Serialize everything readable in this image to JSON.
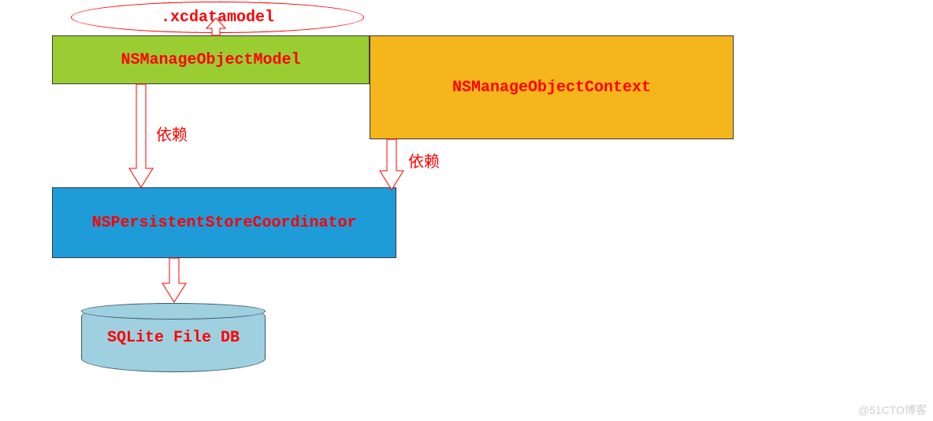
{
  "nodes": {
    "xcdatamodel": ".xcdatamodel",
    "managedObjectModel": "NSManageObjectModel",
    "managedObjectContext": "NSManageObjectContext",
    "persistentStoreCoordinator": "NSPersistentStoreCoordinator",
    "sqliteFileDb": "SQLite File DB"
  },
  "edges": {
    "modelToCoordinator": "依赖",
    "contextToCoordinator": "依赖"
  },
  "watermark": "@51CTO博客",
  "colors": {
    "green": "#9acd32",
    "orange": "#f4b61a",
    "blue": "#1e9cd8",
    "db": "#9ed0df",
    "text": "#ff0000",
    "connector": "#ff0000"
  },
  "chart_data": {
    "type": "diagram",
    "title": "Core Data Stack",
    "nodes": [
      {
        "id": "xcdatamodel",
        "label": ".xcdatamodel",
        "shape": "ellipse-outline"
      },
      {
        "id": "model",
        "label": "NSManageObjectModel",
        "shape": "rect",
        "fill": "#9acd32"
      },
      {
        "id": "context",
        "label": "NSManageObjectContext",
        "shape": "rect",
        "fill": "#f4b61a"
      },
      {
        "id": "coordinator",
        "label": "NSPersistentStoreCoordinator",
        "shape": "rect",
        "fill": "#1e9cd8"
      },
      {
        "id": "sqlite",
        "label": "SQLite File DB",
        "shape": "cylinder",
        "fill": "#9ed0df"
      }
    ],
    "edges": [
      {
        "from": "model",
        "to": "xcdatamodel",
        "style": "open-arrow-up"
      },
      {
        "from": "model",
        "to": "coordinator",
        "label": "依赖",
        "style": "open-arrow-down"
      },
      {
        "from": "context",
        "to": "coordinator",
        "label": "依赖",
        "style": "open-arrow-down"
      },
      {
        "from": "coordinator",
        "to": "sqlite",
        "style": "open-arrow-down"
      }
    ]
  }
}
